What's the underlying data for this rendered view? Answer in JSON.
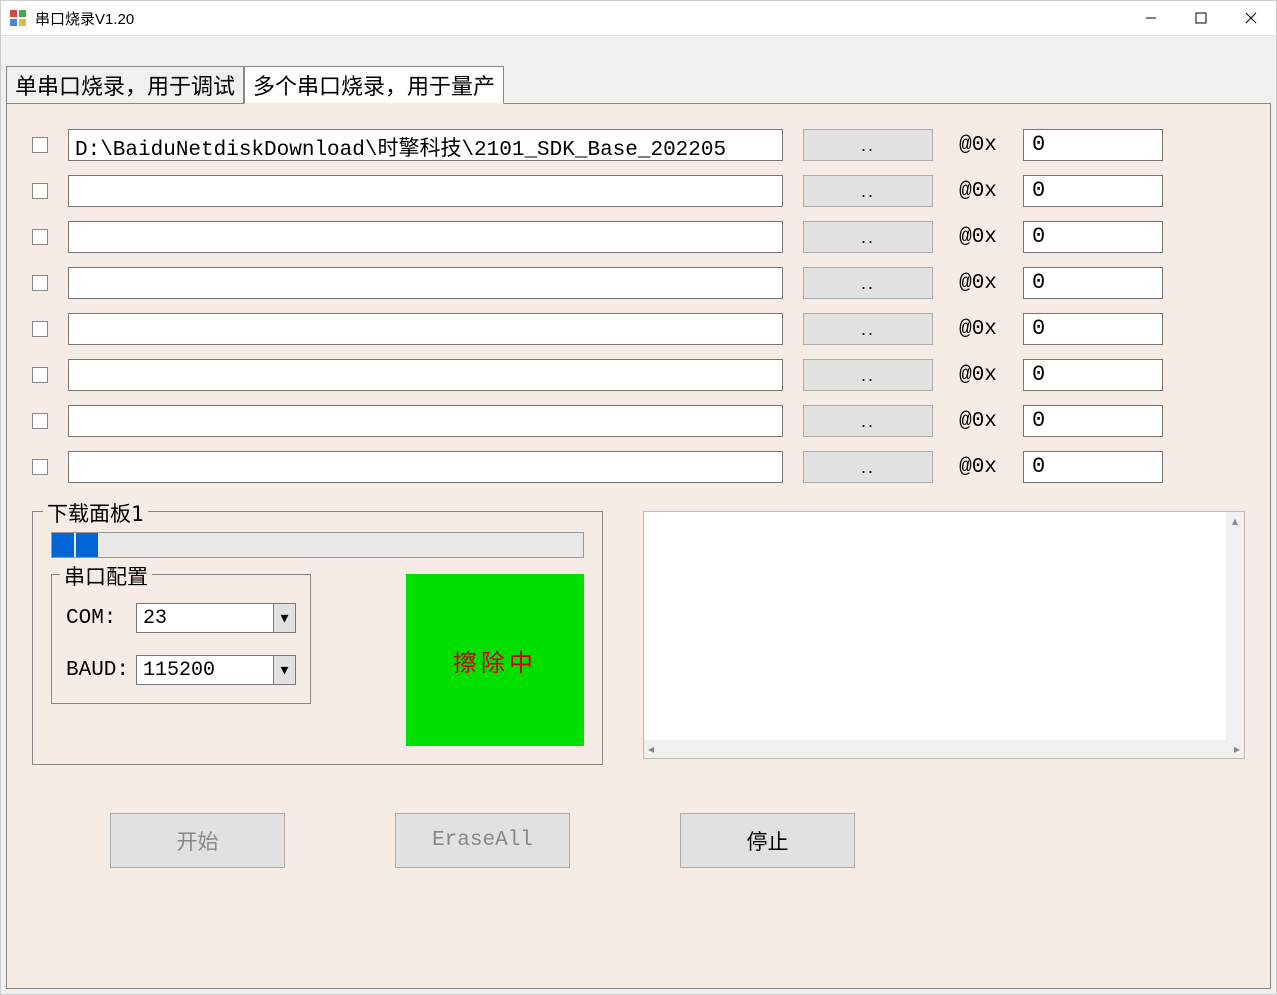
{
  "window": {
    "title": "串口烧录V1.20"
  },
  "tabs": {
    "single": "单串口烧录，用于调试",
    "multi": "多个串口烧录，用于量产"
  },
  "files": {
    "browse_label": "..",
    "addr_prefix": "@0x",
    "rows": [
      {
        "path": "D:\\BaiduNetdiskDownload\\时擎科技\\2101_SDK_Base_202205",
        "addr": "0"
      },
      {
        "path": "",
        "addr": "0"
      },
      {
        "path": "",
        "addr": "0"
      },
      {
        "path": "",
        "addr": "0"
      },
      {
        "path": "",
        "addr": "0"
      },
      {
        "path": "",
        "addr": "0"
      },
      {
        "path": "",
        "addr": "0"
      },
      {
        "path": "",
        "addr": "0"
      }
    ]
  },
  "panel": {
    "title": "下载面板1",
    "serial_title": "串口配置",
    "com_label": "COM:",
    "com_value": "23",
    "baud_label": "BAUD:",
    "baud_value": "115200",
    "status": "擦除中"
  },
  "actions": {
    "start": "开始",
    "erase": "EraseAll",
    "stop": "停止"
  }
}
